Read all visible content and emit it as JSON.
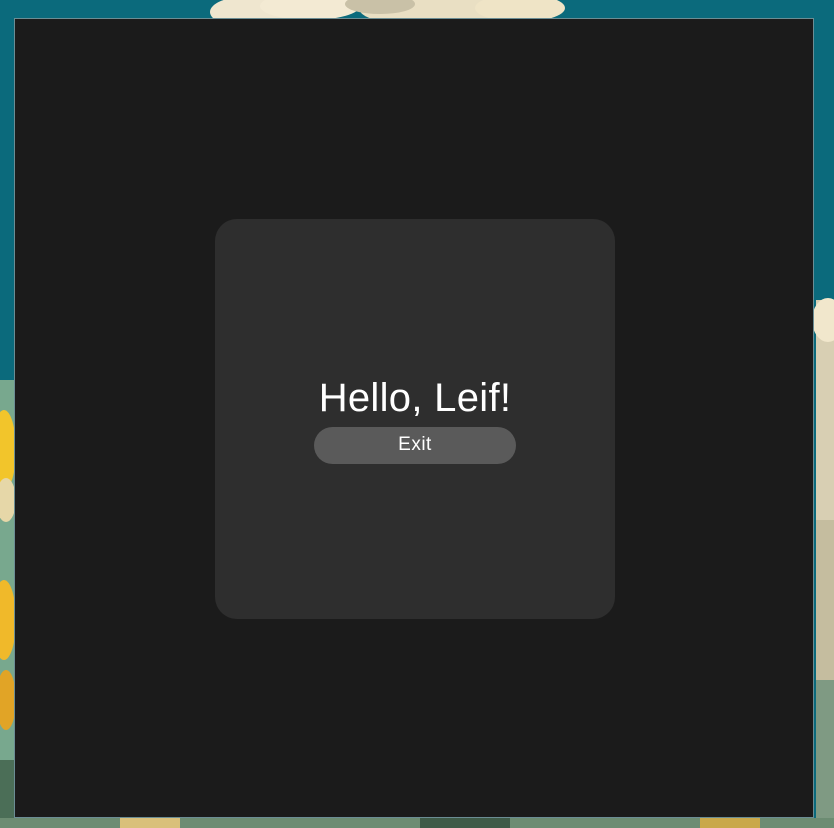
{
  "window": {
    "greeting": "Hello, Leif!",
    "exit_label": "Exit"
  },
  "colors": {
    "wallpaper_sky": "#0b6a7c",
    "window_background": "#1b1b1b",
    "card_background": "#2e2e2e",
    "button_background": "#5a5a5a",
    "text": "#ffffff"
  }
}
